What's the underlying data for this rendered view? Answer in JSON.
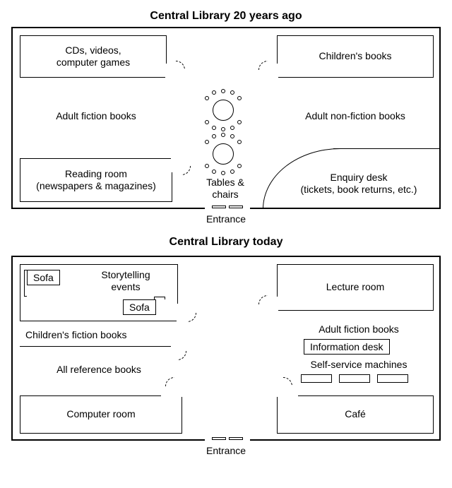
{
  "plan1": {
    "title": "Central Library 20 years ago",
    "cds": "CDs, videos,\ncomputer games",
    "children": "Children's books",
    "adult_fiction": "Adult fiction books",
    "adult_nonfiction": "Adult non-fiction books",
    "reading_room": "Reading room\n(newspapers & magazines)",
    "tables": "Tables &\nchairs",
    "enquiry": "Enquiry desk\n(tickets, book returns, etc.)",
    "entrance": "Entrance"
  },
  "plan2": {
    "title": "Central Library today",
    "sofa": "Sofa",
    "storytelling": "Storytelling\nevents",
    "lecture": "Lecture room",
    "children_fiction": "Children's fiction books",
    "adult_fiction": "Adult fiction books",
    "info_desk": "Information desk",
    "all_ref": "All reference books",
    "self_service": "Self-service machines",
    "computer_room": "Computer room",
    "cafe": "Café",
    "entrance": "Entrance"
  }
}
